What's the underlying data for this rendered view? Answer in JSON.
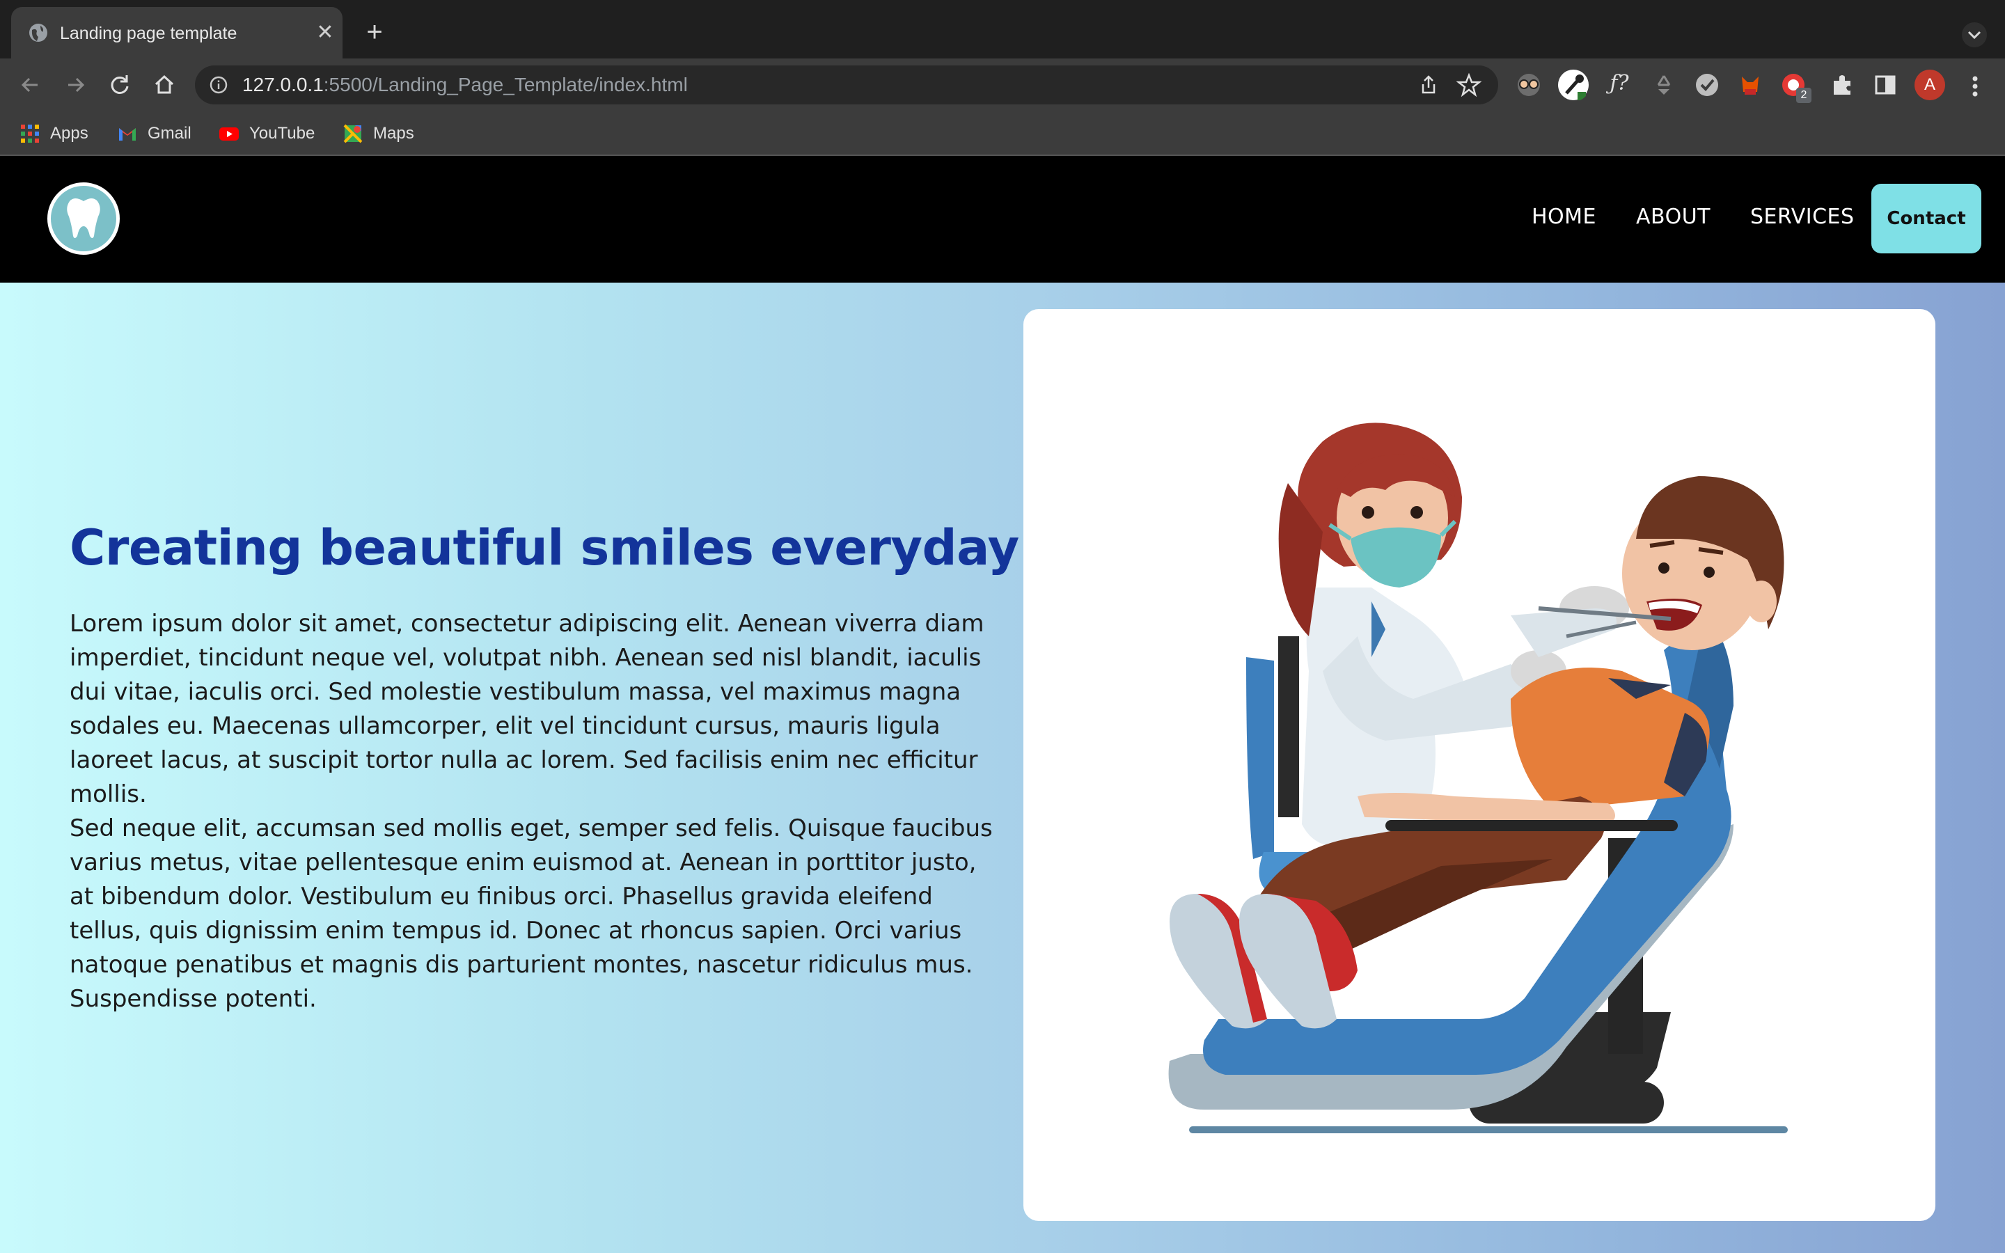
{
  "browser": {
    "tab_title": "Landing page template",
    "url_host": "127.0.0.1",
    "url_path": ":5500/Landing_Page_Template/index.html",
    "avatar_letter": "A",
    "extension_badge": "2",
    "bookmarks": [
      {
        "label": "Apps",
        "icon": "apps-grid-icon"
      },
      {
        "label": "Gmail",
        "icon": "gmail-icon"
      },
      {
        "label": "YouTube",
        "icon": "youtube-icon"
      },
      {
        "label": "Maps",
        "icon": "maps-icon"
      }
    ]
  },
  "site": {
    "nav": {
      "links": [
        "HOME",
        "ABOUT",
        "SERVICES"
      ],
      "contact_label": "Contact"
    },
    "hero": {
      "heading": "Creating beautiful smiles everyday",
      "paragraph1": "Lorem ipsum dolor sit amet, consectetur adipiscing elit. Aenean viverra diam imperdiet, tincidunt neque vel, volutpat nibh. Aenean sed nisl blandit, iaculis dui vitae, iaculis orci. Sed molestie vestibulum massa, vel maximus magna sodales eu. Maecenas ullamcorper, elit vel tincidunt cursus, mauris ligula laoreet lacus, at suscipit tortor nulla ac lorem. Sed facilisis enim nec efficitur mollis.",
      "paragraph2": "Sed neque elit, accumsan sed mollis eget, semper sed felis. Quisque faucibus varius metus, vitae pellentesque enim euismod at. Aenean in porttitor justo, at bibendum dolor. Vestibulum eu finibus orci. Phasellus gravida eleifend tellus, quis dignissim enim tempus id. Donec at rhoncus sapien. Orci varius natoque penatibus et magnis dis parturient montes, nascetur ridiculus mus. Suspendisse potenti."
    }
  },
  "colors": {
    "heading": "#13349a",
    "contact_button": "#7fe0e6",
    "navbar": "#000000",
    "gradient_start": "#c8fafc",
    "gradient_end": "#87a2d2"
  }
}
